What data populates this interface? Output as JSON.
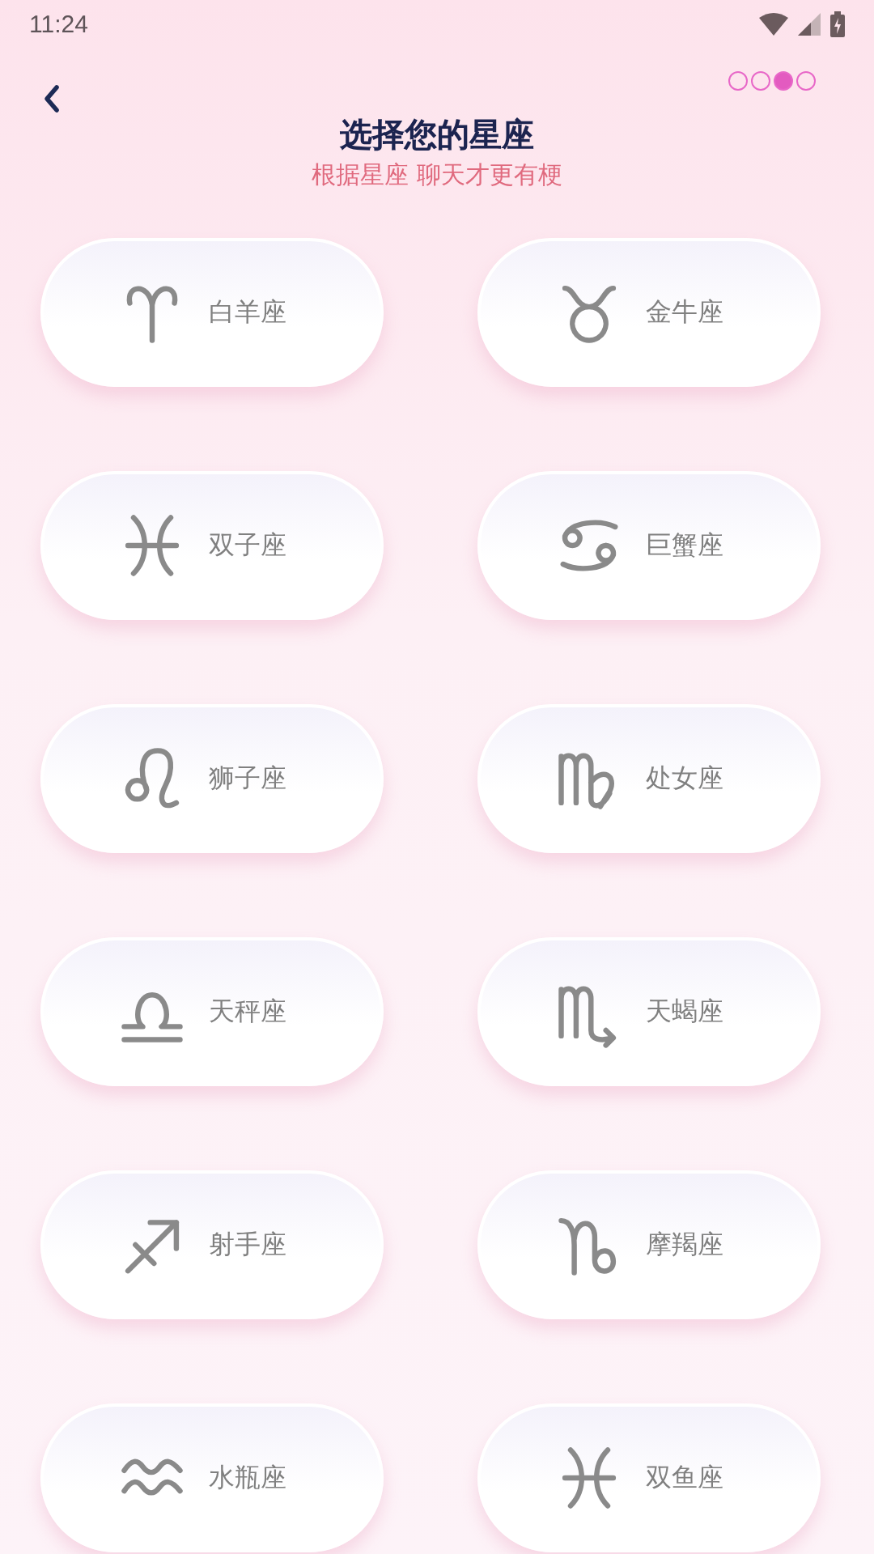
{
  "status_bar": {
    "time": "11:24"
  },
  "progress_steps": [
    {
      "selected": false
    },
    {
      "selected": false
    },
    {
      "selected": true
    },
    {
      "selected": false
    }
  ],
  "header": {
    "title": "选择您的星座",
    "subtitle": "根据星座 聊天才更有梗"
  },
  "signs": [
    {
      "kind": "aries",
      "label": "白羊座"
    },
    {
      "kind": "taurus",
      "label": "金牛座"
    },
    {
      "kind": "gemini",
      "label": "双子座"
    },
    {
      "kind": "cancer",
      "label": "巨蟹座"
    },
    {
      "kind": "leo",
      "label": "狮子座"
    },
    {
      "kind": "virgo",
      "label": "处女座"
    },
    {
      "kind": "libra",
      "label": "天秤座"
    },
    {
      "kind": "scorpio",
      "label": "天蝎座"
    },
    {
      "kind": "sagittarius",
      "label": "射手座"
    },
    {
      "kind": "capricorn",
      "label": "摩羯座"
    },
    {
      "kind": "aquarius",
      "label": "水瓶座"
    },
    {
      "kind": "pisces",
      "label": "双鱼座"
    }
  ]
}
